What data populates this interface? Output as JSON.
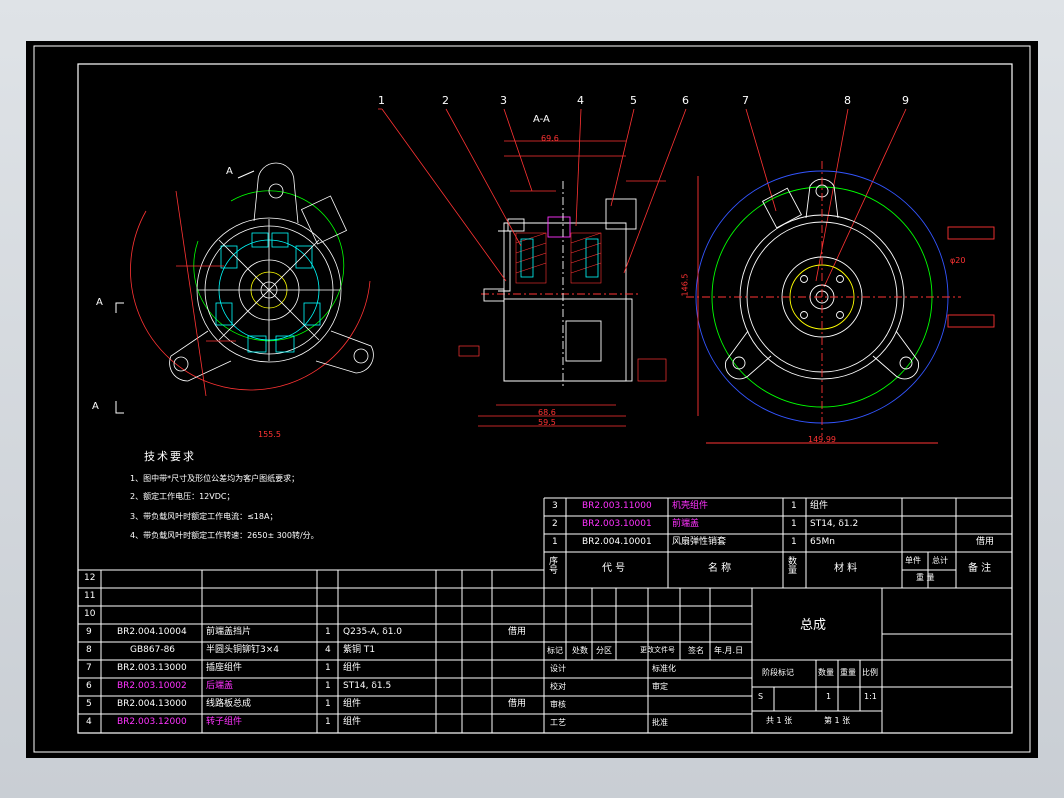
{
  "balloons": [
    "1",
    "2",
    "3",
    "4",
    "5",
    "6",
    "7",
    "8",
    "9"
  ],
  "section_label": "A-A",
  "view_marks": {
    "a_top": "A",
    "a_left1": "A",
    "a_left2": "A"
  },
  "tech": {
    "title": "技术要求",
    "items": [
      "1、图中带*尺寸及形位公差均为客户图纸要求；",
      "2、额定工作电压：12VDC；",
      "3、带负载风叶时额定工作电流：≤18A；",
      "4、带负载风叶时额定工作转速：2650± 300转/分。"
    ]
  },
  "bom_upper": {
    "rows": [
      {
        "no": "3",
        "code": "BR2.003.11000",
        "name": "机壳组件",
        "qty": "1",
        "material": "组件",
        "note": "",
        "color": "magenta"
      },
      {
        "no": "2",
        "code": "BR2.003.10001",
        "name": "前端盖",
        "qty": "1",
        "material": "ST14, δ1.2",
        "note": "",
        "color": "magenta"
      },
      {
        "no": "1",
        "code": "BR2.004.10001",
        "name": "风扇弹性销套",
        "qty": "1",
        "material": "65Mn",
        "note": "借用",
        "color": "white"
      }
    ],
    "header": {
      "no": "序号",
      "code": "代 号",
      "name": "名 称",
      "qty": "数量",
      "material": "材 料",
      "single": "单件",
      "total": "总计",
      "weight": "重 量",
      "note": "备 注"
    }
  },
  "bom_lower": {
    "rows": [
      {
        "no": "12",
        "code": "",
        "name": "",
        "qty": "",
        "material": "",
        "note": "",
        "color": "white"
      },
      {
        "no": "11",
        "code": "",
        "name": "",
        "qty": "",
        "material": "",
        "note": "",
        "color": "white"
      },
      {
        "no": "10",
        "code": "",
        "name": "",
        "qty": "",
        "material": "",
        "note": "",
        "color": "white"
      },
      {
        "no": "9",
        "code": "BR2.004.10004",
        "name": "前端盖挡片",
        "qty": "1",
        "material": "Q235-A, δ1.0",
        "note": "借用",
        "color": "white"
      },
      {
        "no": "8",
        "code": "GB867-86",
        "name": "半圆头铜铆钉3×4",
        "qty": "4",
        "material": "紫铜 T1",
        "note": "",
        "color": "white"
      },
      {
        "no": "7",
        "code": "BR2.003.13000",
        "name": "插座组件",
        "qty": "1",
        "material": "组件",
        "note": "",
        "color": "white"
      },
      {
        "no": "6",
        "code": "BR2.003.10002",
        "name": "后端盖",
        "qty": "1",
        "material": "ST14, δ1.5",
        "note": "",
        "color": "magenta"
      },
      {
        "no": "5",
        "code": "BR2.004.13000",
        "name": "线路板总成",
        "qty": "1",
        "material": "组件",
        "note": "借用",
        "color": "white"
      },
      {
        "no": "4",
        "code": "BR2.003.12000",
        "name": "转子组件",
        "qty": "1",
        "material": "组件",
        "note": "",
        "color": "magenta"
      }
    ]
  },
  "title_block": {
    "name": "总成",
    "mark": "标记",
    "count": "处数",
    "zone": "分区",
    "change_doc": "更改文件号",
    "sign": "签名",
    "date": "年.月.日",
    "design": "设计",
    "std": "标准化",
    "check": "校对",
    "review": "审核",
    "process": "工艺",
    "approve_a": "审定",
    "approve_b": "批准",
    "stage": "阶段标记",
    "qty": "数量",
    "weight": "重量",
    "scale": "比例",
    "stage_val": "S",
    "qty_val": "1",
    "scale_val": "1:1",
    "sheets": "共 1 张",
    "sheet": "第 1 张"
  },
  "dims": {
    "d_phi20": "φ20",
    "d_14999": "149.99",
    "d_1465": "146.5",
    "d_696": "69.6",
    "d_595": "59.5",
    "d_686": "68.6",
    "d_1555": "155.5"
  }
}
